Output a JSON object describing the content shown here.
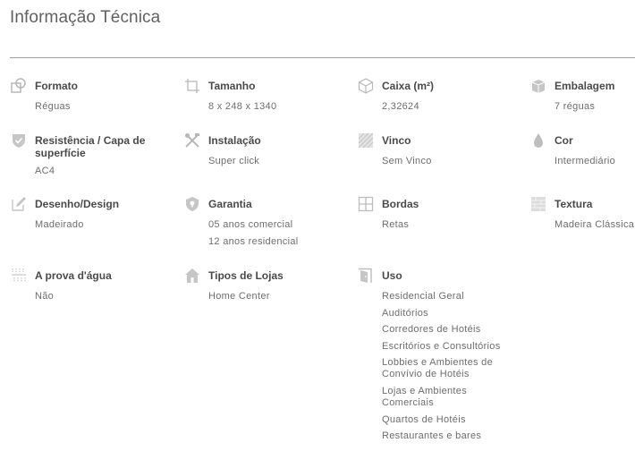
{
  "page": {
    "title": "Informação Técnica"
  },
  "specs": {
    "formato": {
      "label": "Formato",
      "values": [
        "Réguas"
      ]
    },
    "tamanho": {
      "label": "Tamanho",
      "values": [
        "8 x 248 x 1340"
      ]
    },
    "caixa": {
      "label": "Caixa (m²)",
      "values": [
        "2,32624"
      ]
    },
    "embalagem": {
      "label": "Embalagem",
      "values": [
        "7 réguas"
      ]
    },
    "resistencia": {
      "label": "Resistência / Capa de superfície",
      "values": [
        "AC4"
      ]
    },
    "instalacao": {
      "label": "Instalação",
      "values": [
        "Super click"
      ]
    },
    "vinco": {
      "label": "Vinco",
      "values": [
        "Sem Vinco"
      ]
    },
    "cor": {
      "label": "Cor",
      "values": [
        "Intermediário"
      ]
    },
    "desenho": {
      "label": "Desenho/Design",
      "values": [
        "Madeirado"
      ]
    },
    "garantia": {
      "label": "Garantia",
      "values": [
        "05 anos comercial",
        "12 anos residencial"
      ]
    },
    "bordas": {
      "label": "Bordas",
      "values": [
        "Retas"
      ]
    },
    "textura": {
      "label": "Textura",
      "values": [
        "Madeira Clássica"
      ]
    },
    "agua": {
      "label": "A prova d'água",
      "values": [
        "Não"
      ]
    },
    "lojas": {
      "label": "Tipos de Lojas",
      "values": [
        "Home Center"
      ]
    },
    "uso": {
      "label": "Uso",
      "values": [
        "Residencial Geral",
        "Auditórios",
        "Corredores de Hotéis",
        "Escritórios e Consultórios",
        "Lobbies e Ambientes de Convívio de Hotéis",
        "Lojas e Ambientes Comerciais",
        "Quartos de Hotéis",
        "Restaurantes e bares"
      ]
    }
  },
  "icons": {
    "formato": "shapes-icon",
    "tamanho": "crop-icon",
    "caixa": "box-icon",
    "embalagem": "package-icon",
    "resistencia": "shield-check-icon",
    "instalacao": "tools-icon",
    "vinco": "hatch-icon",
    "cor": "drop-icon",
    "desenho": "pencil-icon",
    "garantia": "shield-lock-icon",
    "bordas": "grid-icon",
    "textura": "texture-icon",
    "agua": "water-icon",
    "lojas": "store-icon",
    "uso": "door-icon"
  },
  "colors": {
    "icon": "#b7b7b7",
    "label": "#4a4a4a",
    "value": "#6d6d6d",
    "divider": "#9e9e9e"
  }
}
